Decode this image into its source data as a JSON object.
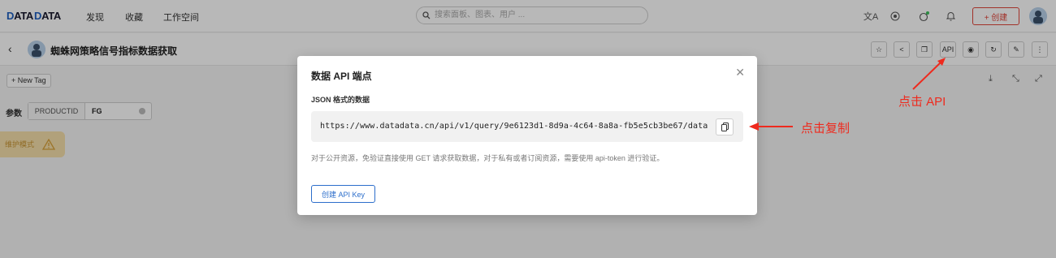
{
  "topnav": {
    "logo_part1": "D",
    "logo_part2": "ATA",
    "logo_part3": "DATA",
    "links": [
      "发现",
      "收藏",
      "工作空间"
    ],
    "search_placeholder": "搜索面板、图表、用户 ...",
    "create_label": "+ 创建",
    "icons": [
      "translate-icon",
      "github-icon",
      "theme-icon",
      "bell-icon"
    ]
  },
  "pagebar": {
    "title": "蜘蛛网策略信号指标数据获取",
    "api_button_label": "API",
    "tools": [
      "star-icon",
      "share-icon",
      "copy-icon",
      "api-icon",
      "camera-icon",
      "refresh-icon",
      "edit-icon",
      "more-icon"
    ]
  },
  "tagbar": {
    "new_tag_label": "+ New Tag"
  },
  "params": {
    "label": "参数",
    "name": "PRODUCTID",
    "value": "FG"
  },
  "maintenance": {
    "label": "维护模式"
  },
  "modal": {
    "title": "数据 API 端点",
    "json_label": "JSON 格式的数据",
    "url": "https://www.datadata.cn/api/v1/query/9e6123d1-8d9a-4c64-8a8a-fb5e5cb3be67/data",
    "description": "对于公开资源，免验证直接使用 GET 请求获取数据，对于私有或者订阅资源，需要使用 api-token 进行验证。",
    "create_key_label": "创建 API Key"
  },
  "annotations": {
    "click_api": "点击 API",
    "click_copy": "点击复制"
  },
  "colors": {
    "accent_red": "#ee2a1e",
    "primary_blue": "#2c6ecb",
    "create_red": "#e0443a"
  }
}
